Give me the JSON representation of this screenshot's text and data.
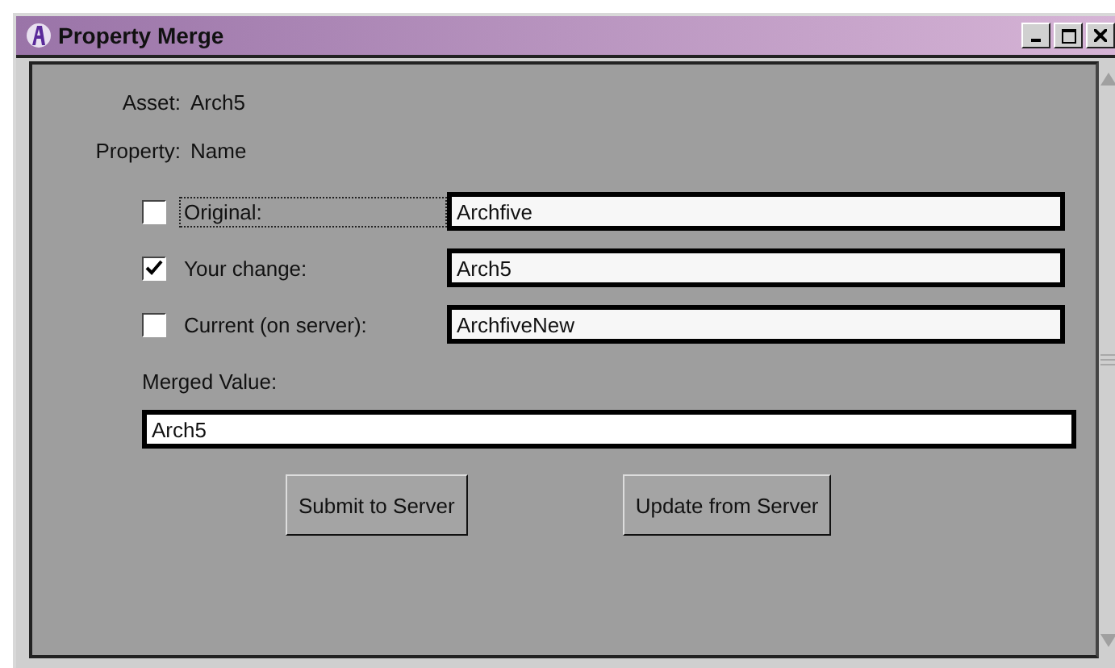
{
  "window": {
    "title": "Property Merge"
  },
  "asset": {
    "label": "Asset:",
    "value": "Arch5"
  },
  "property": {
    "label": "Property:",
    "value": "Name"
  },
  "options": [
    {
      "label": "Original:",
      "checked": false,
      "focused": true,
      "value": "Archfive"
    },
    {
      "label": "Your change:",
      "checked": true,
      "focused": false,
      "value": "Arch5"
    },
    {
      "label": "Current (on server):",
      "checked": false,
      "focused": false,
      "value": "ArchfiveNew"
    }
  ],
  "merged": {
    "label": "Merged Value:",
    "value": "Arch5"
  },
  "buttons": [
    "Submit to Server",
    "Update from Server"
  ]
}
